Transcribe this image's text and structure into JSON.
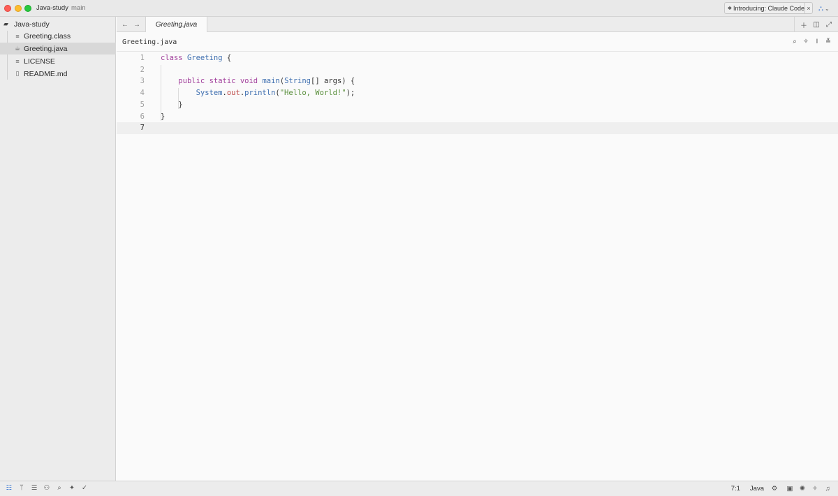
{
  "window": {
    "project": "Java-study",
    "branch": "main",
    "promo_label": "Introducing: Claude Code",
    "promo_close": "×"
  },
  "sidebar": {
    "root": "Java-study",
    "items": [
      {
        "label": "Greeting.class",
        "icon": "≡"
      },
      {
        "label": "Greeting.java",
        "icon": "☕"
      },
      {
        "label": "LICENSE",
        "icon": "≡"
      },
      {
        "label": "README.md",
        "icon": "▯"
      }
    ],
    "active_index": 1
  },
  "tabs": [
    {
      "label": "Greeting.java"
    }
  ],
  "breadcrumb": "Greeting.java",
  "editor": {
    "language": "Java",
    "cursor": "7:1",
    "line_numbers": [
      "1",
      "2",
      "3",
      "4",
      "5",
      "6",
      "7"
    ],
    "current_line": 7
  },
  "colors": {
    "keyword": "#a2409c",
    "type": "#3f6fb0",
    "field": "#c0504d",
    "string": "#5a8f3c",
    "accent": "#2f6fd1"
  }
}
